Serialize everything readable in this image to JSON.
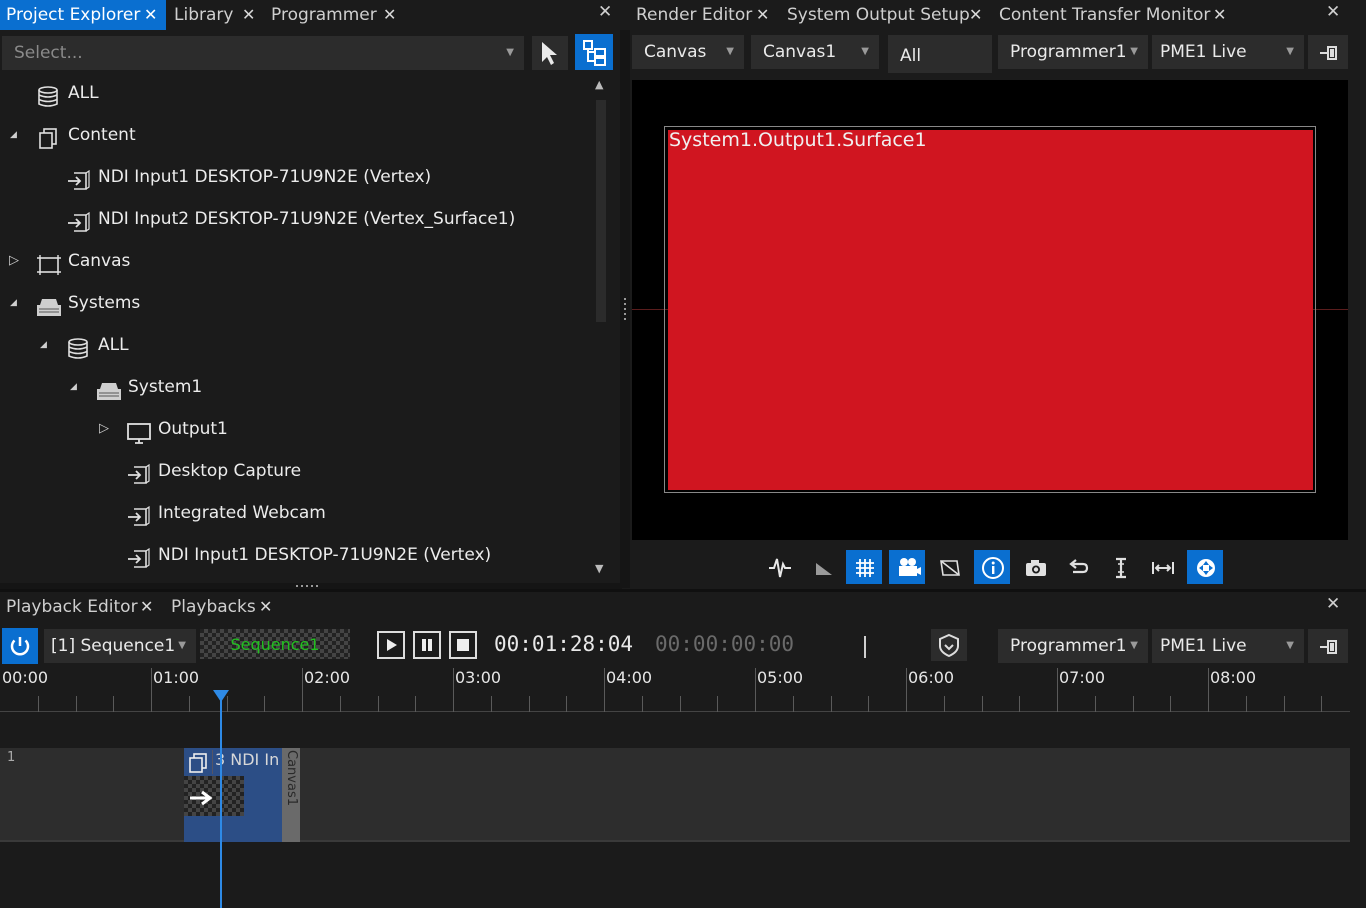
{
  "left_tabs": [
    {
      "label": "Project Explorer",
      "active": true
    },
    {
      "label": "Library",
      "active": false
    },
    {
      "label": "Programmer",
      "active": false
    }
  ],
  "right_tabs": [
    {
      "label": "Render Editor",
      "active": false
    },
    {
      "label": "System Output Setup",
      "active": false
    },
    {
      "label": "Content Transfer Monitor",
      "active": false
    }
  ],
  "close_glyph": "✕",
  "explorer": {
    "select_placeholder": "Select...",
    "tree": [
      {
        "label": "ALL",
        "icon": "database-icon",
        "expander": "",
        "level": 0
      },
      {
        "label": "Content",
        "icon": "content-icon",
        "expander": "expanded",
        "level": 0
      },
      {
        "label": "NDI Input1 DESKTOP-71U9N2E (Vertex)",
        "icon": "input-icon",
        "expander": "",
        "level": 1
      },
      {
        "label": "NDI Input2 DESKTOP-71U9N2E (Vertex_Surface1)",
        "icon": "input-icon",
        "expander": "",
        "level": 1
      },
      {
        "label": "Canvas",
        "icon": "canvas-icon",
        "expander": "collapsed",
        "level": 0
      },
      {
        "label": "Systems",
        "icon": "system-icon",
        "expander": "expanded",
        "level": 0
      },
      {
        "label": "ALL",
        "icon": "database-icon",
        "expander": "expanded",
        "level": 1
      },
      {
        "label": "System1",
        "icon": "system-icon",
        "expander": "expanded",
        "level": 2
      },
      {
        "label": "Output1",
        "icon": "monitor-icon",
        "expander": "collapsed",
        "level": 3
      },
      {
        "label": "Desktop Capture",
        "icon": "input-icon",
        "expander": "",
        "level": 3
      },
      {
        "label": "Integrated Webcam",
        "icon": "input-icon",
        "expander": "",
        "level": 3
      },
      {
        "label": "NDI Input1 DESKTOP-71U9N2E (Vertex)",
        "icon": "input-icon",
        "expander": "",
        "level": 3
      }
    ]
  },
  "render": {
    "dropdowns": [
      "Canvas",
      "Canvas1",
      "All",
      "Programmer1",
      "PME1 Live"
    ],
    "surface_label": "System1.Output1.Surface1",
    "surface_color": "#d01520",
    "toolbar": [
      {
        "icon": "waveform-icon",
        "on": false
      },
      {
        "icon": "corner-icon",
        "on": false
      },
      {
        "icon": "grid-icon",
        "on": true
      },
      {
        "icon": "projector-icon",
        "on": true
      },
      {
        "icon": "mask-icon",
        "on": false
      },
      {
        "icon": "info-icon",
        "on": true
      },
      {
        "icon": "camera-icon",
        "on": false
      },
      {
        "icon": "undo-icon",
        "on": false
      },
      {
        "icon": "text-cursor-icon",
        "on": false
      },
      {
        "icon": "fit-width-icon",
        "on": false
      },
      {
        "icon": "move-icon",
        "on": true
      }
    ]
  },
  "bottom_tabs": [
    {
      "label": "Playback Editor"
    },
    {
      "label": "Playbacks"
    }
  ],
  "playback": {
    "sequence": "[1] Sequence1",
    "preview_label": "Sequence1",
    "timecode": "00:01:28:04",
    "timecode2": "00:00:00:00",
    "programmer": "Programmer1",
    "live": "PME1 Live",
    "ruler": [
      "00:00",
      "01:00",
      "02:00",
      "03:00",
      "04:00",
      "05:00",
      "06:00",
      "07:00",
      "08:00"
    ],
    "track_number": "1",
    "clip_label": "3 NDI In",
    "clip_canvas": "Canvas1",
    "playhead_seconds": 88
  },
  "colors": {
    "accent": "#0a6fd0",
    "panel": "#1b1b1b",
    "dropdown": "#2c2c2c",
    "surface": "#d01520",
    "preview_text": "#22c020"
  }
}
